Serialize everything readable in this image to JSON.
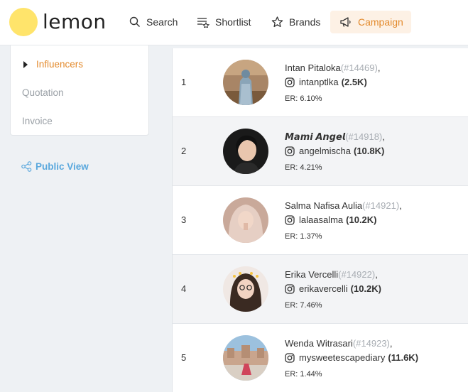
{
  "brand": {
    "logo_text": "lemon"
  },
  "nav": {
    "search": "Search",
    "shortlist": "Shortlist",
    "brands": "Brands",
    "campaign": "Campaign"
  },
  "sidebar": {
    "items": [
      {
        "label": "Influencers",
        "active": true
      },
      {
        "label": "Quotation"
      },
      {
        "label": "Invoice"
      }
    ],
    "public_view": "Public View"
  },
  "colors": {
    "accent": "#e38a2c",
    "accent_bg": "#fdf1e5",
    "link": "#5aa8dd",
    "logo": "#ffe46b"
  },
  "influencers": [
    {
      "rank": "1",
      "name": "Intan Pitaloka",
      "id": "(#14469)",
      "suffix": ",",
      "handle": "intanptlka",
      "followers": "(2.5K)",
      "er": "ER: 6.10%"
    },
    {
      "rank": "2",
      "name": "𝙈𝙖𝙢𝙞 𝘼𝙣𝙜𝙚𝙡",
      "id": "(#14918)",
      "suffix": ",",
      "handle": "angelmischa",
      "followers": "(10.8K)",
      "er": "ER: 4.21%"
    },
    {
      "rank": "3",
      "name": "Salma Nafisa Aulia",
      "id": "(#14921)",
      "suffix": ",",
      "handle": "lalaasalma",
      "followers": "(10.2K)",
      "er": "ER: 1.37%"
    },
    {
      "rank": "4",
      "name": "Erika Vercelli",
      "id": "(#14922)",
      "suffix": ",",
      "handle": "erikavercelli",
      "followers": "(10.2K)",
      "er": "ER: 7.46%"
    },
    {
      "rank": "5",
      "name": "Wenda Witrasari",
      "id": "(#14923)",
      "suffix": ",",
      "handle": "mysweetescapediary",
      "followers": "(11.6K)",
      "er": "ER: 1.44%"
    }
  ]
}
